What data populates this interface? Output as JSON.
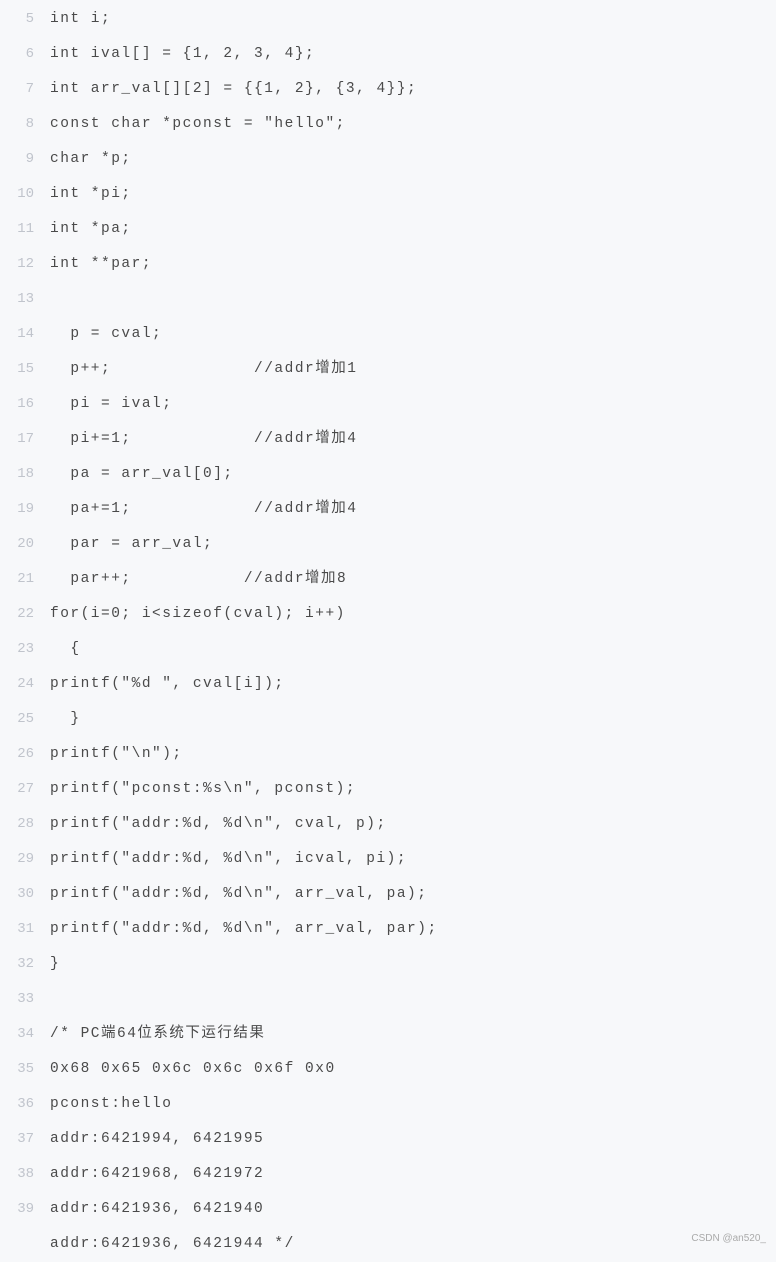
{
  "gutter_start": 5,
  "gutter_end": 39,
  "lines": [
    "int i;",
    "int ival[] = {1, 2, 3, 4};",
    "int arr_val[][2] = {{1, 2}, {3, 4}};",
    "const char *pconst = \"hello\";",
    "char *p;",
    "int *pi;",
    "int *pa;",
    "int **par;",
    "",
    "  p = cval;",
    "  p++;              //addr增加1",
    "  pi = ival;",
    "  pi+=1;            //addr增加4",
    "  pa = arr_val[0];",
    "  pa+=1;            //addr增加4",
    "  par = arr_val;",
    "  par++;           //addr增加8",
    "for(i=0; i<sizeof(cval); i++)",
    "  {",
    "printf(\"%d \", cval[i]);",
    "  }",
    "printf(\"\\n\");",
    "printf(\"pconst:%s\\n\", pconst);",
    "printf(\"addr:%d, %d\\n\", cval, p);",
    "printf(\"addr:%d, %d\\n\", icval, pi);",
    "printf(\"addr:%d, %d\\n\", arr_val, pa);",
    "printf(\"addr:%d, %d\\n\", arr_val, par);",
    "}",
    "",
    "/* PC端64位系统下运行结果",
    "0x68 0x65 0x6c 0x6c 0x6f 0x0",
    "pconst:hello",
    "addr:6421994, 6421995",
    "addr:6421968, 6421972",
    "addr:6421936, 6421940",
    "addr:6421936, 6421944 */"
  ],
  "watermark": "CSDN @an520_"
}
